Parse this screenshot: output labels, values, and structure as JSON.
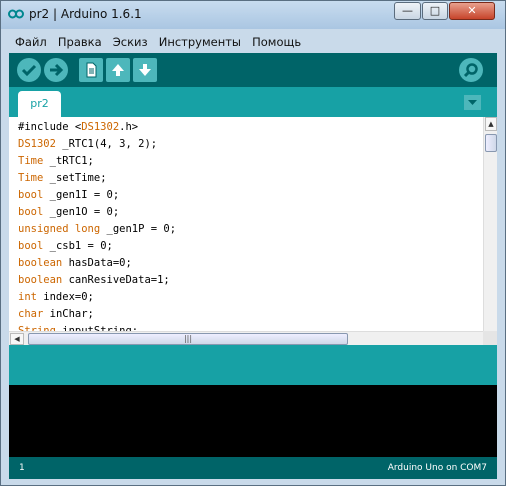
{
  "window": {
    "title": "pr2 | Arduino 1.6.1"
  },
  "menu": [
    "Файл",
    "Правка",
    "Эскиз",
    "Инструменты",
    "Помощь"
  ],
  "toolbar": {
    "verify": "verify-icon",
    "upload": "arrow-right-icon",
    "new": "new-file-icon",
    "open": "arrow-up-icon",
    "save": "arrow-down-icon",
    "serial": "magnifier-icon"
  },
  "tabs": [
    {
      "label": "pr2"
    }
  ],
  "code": [
    [
      [
        "#include <",
        ""
      ],
      [
        "DS1302",
        "kw"
      ],
      [
        ".h>",
        ""
      ]
    ],
    [
      [
        "DS1302",
        "kw"
      ],
      [
        " _RTC1(4, 3, 2);",
        ""
      ]
    ],
    [
      [
        "Time",
        "kw"
      ],
      [
        " _tRTC1;",
        ""
      ]
    ],
    [
      [
        "Time",
        "kw"
      ],
      [
        " _setTime;",
        ""
      ]
    ],
    [
      [
        "bool",
        "kw"
      ],
      [
        " _gen1I = 0;",
        ""
      ]
    ],
    [
      [
        "bool",
        "kw"
      ],
      [
        " _gen1O = 0;",
        ""
      ]
    ],
    [
      [
        "unsigned",
        "kw"
      ],
      [
        " ",
        ""
      ],
      [
        "long",
        "kw"
      ],
      [
        " _gen1P = 0;",
        ""
      ]
    ],
    [
      [
        "bool",
        "kw"
      ],
      [
        " _csb1 = 0;",
        ""
      ]
    ],
    [
      [
        "boolean",
        "kw"
      ],
      [
        " hasData=0;",
        ""
      ]
    ],
    [
      [
        "boolean",
        "kw"
      ],
      [
        " canResiveData=1;",
        ""
      ]
    ],
    [
      [
        "int",
        "kw"
      ],
      [
        " index=0;",
        ""
      ]
    ],
    [
      [
        "char",
        "kw"
      ],
      [
        " inChar;",
        ""
      ]
    ],
    [
      [
        "String",
        "kw"
      ],
      [
        " inputString;",
        ""
      ]
    ]
  ],
  "status": {
    "line": "1",
    "board": "Arduino Uno on COM7"
  },
  "colors": {
    "toolbar": "#006468",
    "tabbar": "#17a1a5",
    "button": "#4db7bb",
    "keyword": "#cc6600"
  }
}
